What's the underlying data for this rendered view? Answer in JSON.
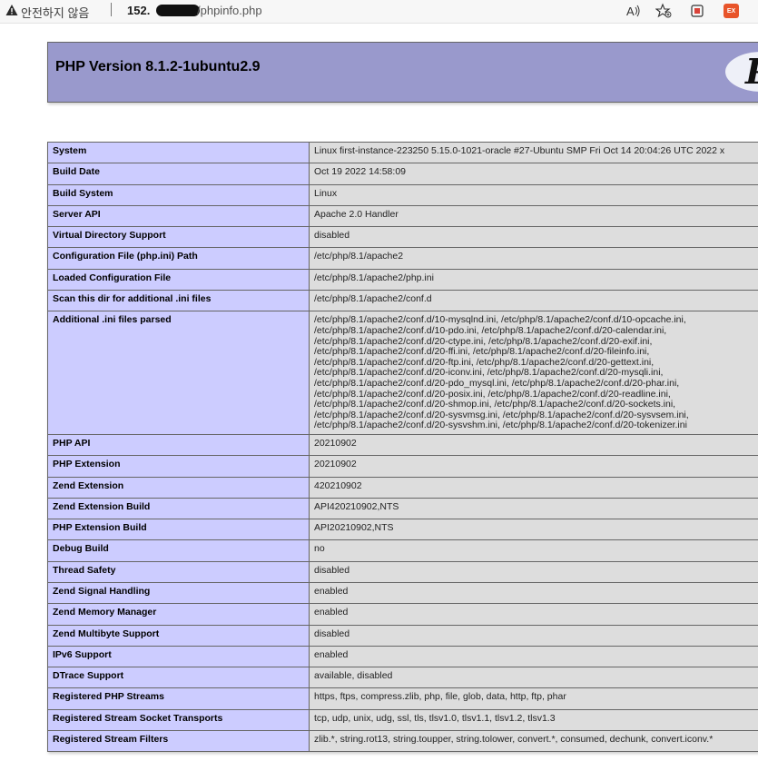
{
  "browser": {
    "security_label": "안전하지 않음",
    "url_host": "152.",
    "url_path": "/phpinfo.php",
    "read_aloud_label": "A",
    "extension_badge": "EX"
  },
  "page": {
    "title": "PHP Version 8.1.2-1ubuntu2.9",
    "logo_text": "P"
  },
  "rows": [
    {
      "key": "System",
      "value": "Linux first-instance-223250 5.15.0-1021-oracle #27-Ubuntu SMP Fri Oct 14 20:04:26 UTC 2022 x"
    },
    {
      "key": "Build Date",
      "value": "Oct 19 2022 14:58:09"
    },
    {
      "key": "Build System",
      "value": "Linux"
    },
    {
      "key": "Server API",
      "value": "Apache 2.0 Handler"
    },
    {
      "key": "Virtual Directory Support",
      "value": "disabled"
    },
    {
      "key": "Configuration File (php.ini) Path",
      "value": "/etc/php/8.1/apache2"
    },
    {
      "key": "Loaded Configuration File",
      "value": "/etc/php/8.1/apache2/php.ini"
    },
    {
      "key": "Scan this dir for additional .ini files",
      "value": "/etc/php/8.1/apache2/conf.d"
    },
    {
      "key": "Additional .ini files parsed",
      "lines": [
        "/etc/php/8.1/apache2/conf.d/10-mysqlnd.ini, /etc/php/8.1/apache2/conf.d/10-opcache.ini,",
        "/etc/php/8.1/apache2/conf.d/10-pdo.ini, /etc/php/8.1/apache2/conf.d/20-calendar.ini,",
        "/etc/php/8.1/apache2/conf.d/20-ctype.ini, /etc/php/8.1/apache2/conf.d/20-exif.ini,",
        "/etc/php/8.1/apache2/conf.d/20-ffi.ini, /etc/php/8.1/apache2/conf.d/20-fileinfo.ini,",
        "/etc/php/8.1/apache2/conf.d/20-ftp.ini, /etc/php/8.1/apache2/conf.d/20-gettext.ini,",
        "/etc/php/8.1/apache2/conf.d/20-iconv.ini, /etc/php/8.1/apache2/conf.d/20-mysqli.ini,",
        "/etc/php/8.1/apache2/conf.d/20-pdo_mysql.ini, /etc/php/8.1/apache2/conf.d/20-phar.ini,",
        "/etc/php/8.1/apache2/conf.d/20-posix.ini, /etc/php/8.1/apache2/conf.d/20-readline.ini,",
        "/etc/php/8.1/apache2/conf.d/20-shmop.ini, /etc/php/8.1/apache2/conf.d/20-sockets.ini,",
        "/etc/php/8.1/apache2/conf.d/20-sysvmsg.ini, /etc/php/8.1/apache2/conf.d/20-sysvsem.ini,",
        "/etc/php/8.1/apache2/conf.d/20-sysvshm.ini, /etc/php/8.1/apache2/conf.d/20-tokenizer.ini"
      ]
    },
    {
      "key": "PHP API",
      "value": "20210902"
    },
    {
      "key": "PHP Extension",
      "value": "20210902"
    },
    {
      "key": "Zend Extension",
      "value": "420210902"
    },
    {
      "key": "Zend Extension Build",
      "value": "API420210902,NTS"
    },
    {
      "key": "PHP Extension Build",
      "value": "API20210902,NTS"
    },
    {
      "key": "Debug Build",
      "value": "no"
    },
    {
      "key": "Thread Safety",
      "value": "disabled"
    },
    {
      "key": "Zend Signal Handling",
      "value": "enabled"
    },
    {
      "key": "Zend Memory Manager",
      "value": "enabled"
    },
    {
      "key": "Zend Multibyte Support",
      "value": "disabled"
    },
    {
      "key": "IPv6 Support",
      "value": "enabled"
    },
    {
      "key": "DTrace Support",
      "value": "available, disabled"
    },
    {
      "key": "Registered PHP Streams",
      "value": "https, ftps, compress.zlib, php, file, glob, data, http, ftp, phar"
    },
    {
      "key": "Registered Stream Socket Transports",
      "value": "tcp, udp, unix, udg, ssl, tls, tlsv1.0, tlsv1.1, tlsv1.2, tlsv1.3"
    },
    {
      "key": "Registered Stream Filters",
      "value": "zlib.*, string.rot13, string.toupper, string.tolower, convert.*, consumed, dechunk, convert.iconv.*"
    }
  ]
}
